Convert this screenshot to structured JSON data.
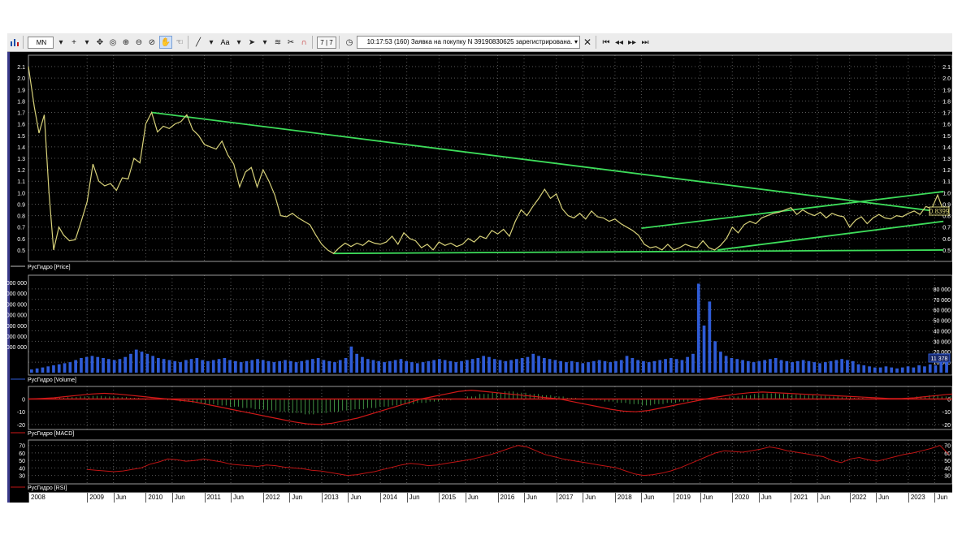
{
  "toolbar": {
    "timeframe": "MN",
    "font_label": "Aa",
    "page_indicator": "7 | 7",
    "message": "10:17:53  (160) Заявка на покупку N 39190830625 зарегистрирована."
  },
  "price_panel": {
    "legend": "РусГидро [Price]",
    "current_value": "0.8399",
    "y_ticks": [
      "2.1",
      "2.0",
      "1.9",
      "1.8",
      "1.7",
      "1.6",
      "1.5",
      "1.4",
      "1.3",
      "1.2",
      "1.1",
      "1.0",
      "0.9",
      "0.8",
      "0.7",
      "0.6",
      "0.5"
    ]
  },
  "volume_panel": {
    "legend": "РусГидро [Volume]",
    "current_value": "11 378",
    "right_ticks": [
      "80 000",
      "70 000",
      "60 000",
      "50 000",
      "40 000",
      "30 000",
      "20 000",
      "10 000"
    ],
    "left_ticks": [
      "000 000",
      "000 000",
      "000 000",
      "000 000",
      "000 000",
      "000 000",
      "000 000"
    ]
  },
  "macd_panel": {
    "legend": "РусГидро [MACD]",
    "ticks": [
      "0",
      "-10",
      "-20"
    ],
    "left_ticks": [
      "0",
      "-10",
      "-20"
    ]
  },
  "rsi_panel": {
    "legend": "РусГидро [RSI]",
    "ticks": [
      "70",
      "60",
      "50",
      "40",
      "30"
    ],
    "left_ticks": [
      "70",
      "60",
      "50",
      "40",
      "30"
    ]
  },
  "time_axis": [
    {
      "label": "2008",
      "t": 2008.0
    },
    {
      "label": "2009",
      "t": 2009.0
    },
    {
      "label": "Jun",
      "t": 2009.45
    },
    {
      "label": "2010",
      "t": 2010.0
    },
    {
      "label": "Jun",
      "t": 2010.45
    },
    {
      "label": "2011",
      "t": 2011.0
    },
    {
      "label": "Jun",
      "t": 2011.45
    },
    {
      "label": "2012",
      "t": 2012.0
    },
    {
      "label": "Jun",
      "t": 2012.45
    },
    {
      "label": "2013",
      "t": 2013.0
    },
    {
      "label": "Jun",
      "t": 2013.45
    },
    {
      "label": "2014",
      "t": 2014.0
    },
    {
      "label": "Jun",
      "t": 2014.45
    },
    {
      "label": "2015",
      "t": 2015.0
    },
    {
      "label": "Jun",
      "t": 2015.45
    },
    {
      "label": "2016",
      "t": 2016.0
    },
    {
      "label": "Jun",
      "t": 2016.45
    },
    {
      "label": "2017",
      "t": 2017.0
    },
    {
      "label": "Jun",
      "t": 2017.45
    },
    {
      "label": "2018",
      "t": 2018.0
    },
    {
      "label": "Jun",
      "t": 2018.45
    },
    {
      "label": "2019",
      "t": 2019.0
    },
    {
      "label": "Jun",
      "t": 2019.45
    },
    {
      "label": "2020",
      "t": 2020.0
    },
    {
      "label": "Jun",
      "t": 2020.45
    },
    {
      "label": "2021",
      "t": 2021.0
    },
    {
      "label": "Jun",
      "t": 2021.45
    },
    {
      "label": "2022",
      "t": 2022.0
    },
    {
      "label": "Jun",
      "t": 2022.45
    },
    {
      "label": "2023",
      "t": 2023.0
    },
    {
      "label": "Jun",
      "t": 2023.45
    }
  ],
  "colors": {
    "background": "#000000",
    "grid": "#5a5a5a",
    "price_line": "#d8d27a",
    "trendline": "#3ddc5a",
    "volume_bar": "#2e5bd6",
    "macd_line": "#d01818",
    "macd_hist": "#4caf50",
    "rsi_line": "#c01414",
    "axis_text": "#ffffff"
  },
  "chart_data": {
    "type": "line",
    "x_range": [
      2008.0,
      2023.75
    ],
    "price": {
      "ylim": [
        0.45,
        2.15
      ],
      "points": [
        [
          2008.0,
          2.1
        ],
        [
          2008.1,
          1.75
        ],
        [
          2008.18,
          1.52
        ],
        [
          2008.27,
          1.68
        ],
        [
          2008.35,
          1.0
        ],
        [
          2008.43,
          0.5
        ],
        [
          2008.52,
          0.7
        ],
        [
          2008.6,
          0.63
        ],
        [
          2008.7,
          0.58
        ],
        [
          2008.8,
          0.59
        ],
        [
          2008.9,
          0.75
        ],
        [
          2009.0,
          0.92
        ],
        [
          2009.1,
          1.25
        ],
        [
          2009.2,
          1.1
        ],
        [
          2009.3,
          1.06
        ],
        [
          2009.4,
          1.08
        ],
        [
          2009.5,
          1.02
        ],
        [
          2009.6,
          1.13
        ],
        [
          2009.7,
          1.12
        ],
        [
          2009.8,
          1.3
        ],
        [
          2009.9,
          1.26
        ],
        [
          2010.0,
          1.6
        ],
        [
          2010.1,
          1.7
        ],
        [
          2010.2,
          1.53
        ],
        [
          2010.3,
          1.58
        ],
        [
          2010.4,
          1.56
        ],
        [
          2010.5,
          1.6
        ],
        [
          2010.6,
          1.62
        ],
        [
          2010.7,
          1.68
        ],
        [
          2010.8,
          1.55
        ],
        [
          2010.9,
          1.5
        ],
        [
          2011.0,
          1.42
        ],
        [
          2011.1,
          1.4
        ],
        [
          2011.2,
          1.38
        ],
        [
          2011.3,
          1.45
        ],
        [
          2011.4,
          1.33
        ],
        [
          2011.5,
          1.25
        ],
        [
          2011.6,
          1.05
        ],
        [
          2011.7,
          1.18
        ],
        [
          2011.8,
          1.22
        ],
        [
          2011.9,
          1.05
        ],
        [
          2012.0,
          1.2
        ],
        [
          2012.1,
          1.1
        ],
        [
          2012.2,
          0.98
        ],
        [
          2012.3,
          0.8
        ],
        [
          2012.4,
          0.79
        ],
        [
          2012.5,
          0.82
        ],
        [
          2012.6,
          0.78
        ],
        [
          2012.7,
          0.75
        ],
        [
          2012.8,
          0.72
        ],
        [
          2012.9,
          0.63
        ],
        [
          2013.0,
          0.55
        ],
        [
          2013.1,
          0.5
        ],
        [
          2013.2,
          0.47
        ],
        [
          2013.3,
          0.52
        ],
        [
          2013.4,
          0.56
        ],
        [
          2013.5,
          0.53
        ],
        [
          2013.6,
          0.56
        ],
        [
          2013.7,
          0.54
        ],
        [
          2013.8,
          0.58
        ],
        [
          2013.9,
          0.56
        ],
        [
          2014.0,
          0.55
        ],
        [
          2014.1,
          0.57
        ],
        [
          2014.2,
          0.62
        ],
        [
          2014.3,
          0.55
        ],
        [
          2014.4,
          0.65
        ],
        [
          2014.5,
          0.6
        ],
        [
          2014.6,
          0.58
        ],
        [
          2014.7,
          0.52
        ],
        [
          2014.8,
          0.55
        ],
        [
          2014.9,
          0.5
        ],
        [
          2015.0,
          0.57
        ],
        [
          2015.1,
          0.54
        ],
        [
          2015.2,
          0.56
        ],
        [
          2015.3,
          0.53
        ],
        [
          2015.4,
          0.55
        ],
        [
          2015.5,
          0.6
        ],
        [
          2015.6,
          0.57
        ],
        [
          2015.7,
          0.62
        ],
        [
          2015.8,
          0.6
        ],
        [
          2015.9,
          0.67
        ],
        [
          2016.0,
          0.64
        ],
        [
          2016.1,
          0.68
        ],
        [
          2016.2,
          0.62
        ],
        [
          2016.3,
          0.75
        ],
        [
          2016.4,
          0.85
        ],
        [
          2016.5,
          0.8
        ],
        [
          2016.6,
          0.88
        ],
        [
          2016.7,
          0.95
        ],
        [
          2016.8,
          1.03
        ],
        [
          2016.9,
          0.95
        ],
        [
          2017.0,
          0.99
        ],
        [
          2017.1,
          0.86
        ],
        [
          2017.2,
          0.8
        ],
        [
          2017.3,
          0.78
        ],
        [
          2017.4,
          0.82
        ],
        [
          2017.5,
          0.77
        ],
        [
          2017.6,
          0.84
        ],
        [
          2017.7,
          0.79
        ],
        [
          2017.8,
          0.78
        ],
        [
          2017.9,
          0.75
        ],
        [
          2018.0,
          0.77
        ],
        [
          2018.1,
          0.73
        ],
        [
          2018.2,
          0.7
        ],
        [
          2018.3,
          0.67
        ],
        [
          2018.4,
          0.63
        ],
        [
          2018.5,
          0.55
        ],
        [
          2018.6,
          0.52
        ],
        [
          2018.7,
          0.53
        ],
        [
          2018.8,
          0.5
        ],
        [
          2018.9,
          0.55
        ],
        [
          2019.0,
          0.5
        ],
        [
          2019.1,
          0.52
        ],
        [
          2019.2,
          0.55
        ],
        [
          2019.3,
          0.53
        ],
        [
          2019.4,
          0.52
        ],
        [
          2019.5,
          0.58
        ],
        [
          2019.6,
          0.52
        ],
        [
          2019.7,
          0.5
        ],
        [
          2019.8,
          0.54
        ],
        [
          2019.9,
          0.6
        ],
        [
          2020.0,
          0.7
        ],
        [
          2020.1,
          0.65
        ],
        [
          2020.2,
          0.72
        ],
        [
          2020.3,
          0.75
        ],
        [
          2020.4,
          0.73
        ],
        [
          2020.5,
          0.78
        ],
        [
          2020.6,
          0.8
        ],
        [
          2020.7,
          0.82
        ],
        [
          2020.8,
          0.83
        ],
        [
          2020.9,
          0.85
        ],
        [
          2021.0,
          0.87
        ],
        [
          2021.1,
          0.81
        ],
        [
          2021.2,
          0.85
        ],
        [
          2021.3,
          0.82
        ],
        [
          2021.4,
          0.8
        ],
        [
          2021.5,
          0.83
        ],
        [
          2021.6,
          0.78
        ],
        [
          2021.7,
          0.82
        ],
        [
          2021.8,
          0.8
        ],
        [
          2021.9,
          0.79
        ],
        [
          2022.0,
          0.7
        ],
        [
          2022.1,
          0.76
        ],
        [
          2022.2,
          0.79
        ],
        [
          2022.3,
          0.73
        ],
        [
          2022.4,
          0.78
        ],
        [
          2022.5,
          0.81
        ],
        [
          2022.6,
          0.78
        ],
        [
          2022.7,
          0.77
        ],
        [
          2022.8,
          0.8
        ],
        [
          2022.9,
          0.79
        ],
        [
          2023.0,
          0.82
        ],
        [
          2023.1,
          0.84
        ],
        [
          2023.2,
          0.81
        ],
        [
          2023.3,
          0.88
        ],
        [
          2023.4,
          0.86
        ],
        [
          2023.5,
          0.98
        ],
        [
          2023.6,
          0.84
        ]
      ]
    },
    "trendlines": [
      {
        "from": [
          2010.1,
          1.7
        ],
        "to": [
          2023.6,
          0.83
        ]
      },
      {
        "from": [
          2013.2,
          0.47
        ],
        "to": [
          2023.6,
          0.5
        ]
      },
      {
        "from": [
          2018.45,
          0.69
        ],
        "to": [
          2023.6,
          1.01
        ]
      },
      {
        "from": [
          2019.75,
          0.5
        ],
        "to": [
          2023.6,
          0.75
        ]
      }
    ],
    "volume": {
      "ylim": [
        0,
        90000
      ],
      "bars": [
        3000,
        4000,
        5000,
        6000,
        7000,
        8000,
        9000,
        10000,
        12000,
        14000,
        15000,
        16000,
        15000,
        14000,
        13000,
        12000,
        13000,
        15000,
        18000,
        22000,
        20000,
        18000,
        16000,
        14000,
        13000,
        12000,
        11000,
        10000,
        12000,
        13000,
        14000,
        12000,
        11000,
        12000,
        13000,
        14000,
        12000,
        11000,
        10000,
        11000,
        12000,
        13000,
        12000,
        11000,
        10000,
        11000,
        12000,
        11000,
        10000,
        11000,
        12000,
        13000,
        14000,
        12000,
        11000,
        10000,
        12000,
        14000,
        25000,
        18000,
        15000,
        13000,
        12000,
        11000,
        10000,
        11000,
        12000,
        13000,
        11000,
        10000,
        9000,
        10000,
        11000,
        12000,
        13000,
        12000,
        11000,
        10000,
        11000,
        12000,
        13000,
        14000,
        16000,
        15000,
        13000,
        12000,
        11000,
        12000,
        13000,
        14000,
        15000,
        18000,
        16000,
        14000,
        13000,
        12000,
        11000,
        10000,
        11000,
        10000,
        9000,
        10000,
        11000,
        12000,
        11000,
        10000,
        11000,
        12000,
        16000,
        14000,
        12000,
        11000,
        10000,
        11000,
        12000,
        13000,
        14000,
        13000,
        12000,
        15000,
        18000,
        85000,
        45000,
        68000,
        30000,
        20000,
        16000,
        14000,
        13000,
        12000,
        11000,
        10000,
        11000,
        12000,
        13000,
        14000,
        12000,
        11000,
        10000,
        11000,
        12000,
        11000,
        10000,
        9000,
        10000,
        11000,
        12000,
        13000,
        12000,
        11000,
        8000,
        7000,
        6000,
        5000,
        5000,
        6000,
        5000,
        4000,
        5000,
        6000,
        5000,
        7000,
        6000,
        8000,
        7000,
        15000,
        11378
      ]
    },
    "macd": {
      "ylim": [
        -22,
        8
      ],
      "line": [
        0,
        0.5,
        1,
        2,
        3,
        4,
        4.5,
        4,
        3,
        2,
        1,
        0,
        -1,
        -2,
        -4,
        -6,
        -8,
        -10,
        -12,
        -14,
        -16,
        -18,
        -19.5,
        -20,
        -19,
        -17,
        -15,
        -12,
        -9,
        -6,
        -3,
        0,
        2,
        4,
        6,
        7,
        6,
        5,
        4,
        3,
        2,
        1,
        0,
        -2,
        -4,
        -6,
        -8,
        -9.5,
        -10,
        -9,
        -7,
        -5,
        -3,
        -1,
        1,
        2.5,
        4,
        5,
        5.5,
        5,
        4.5,
        4,
        3.5,
        3,
        2.5,
        2,
        1.5,
        1,
        0.5,
        0.5,
        1,
        2,
        3,
        4
      ],
      "histogram": [
        0,
        0.5,
        1,
        1.5,
        2,
        2.5,
        2,
        1.5,
        1,
        0.5,
        0,
        -1,
        -2,
        -3,
        -4,
        -5,
        -6,
        -7,
        -8,
        -9,
        -10,
        -11,
        -12,
        -11,
        -10,
        -9,
        -8,
        -7,
        -6,
        -5,
        -4,
        -3,
        -2,
        -1,
        0,
        2,
        4,
        5,
        6,
        5,
        4,
        3,
        2,
        1,
        0,
        -1,
        -2,
        -3,
        -4,
        -5,
        -4,
        -3,
        -2,
        -1,
        0,
        1,
        2,
        3,
        4,
        4.5,
        4,
        3.5,
        3,
        2.5,
        2,
        1.5,
        1,
        0.5,
        0,
        0.5,
        1,
        2,
        3,
        2
      ]
    },
    "rsi": {
      "ylim": [
        22,
        74
      ],
      "line": [
        38,
        37,
        36,
        35,
        36,
        38,
        40,
        45,
        48,
        52,
        51,
        49,
        50,
        52,
        50,
        48,
        45,
        44,
        43,
        42,
        44,
        43,
        41,
        40,
        39,
        37,
        36,
        34,
        32,
        30,
        31,
        33,
        35,
        38,
        41,
        44,
        46,
        45,
        43,
        44,
        46,
        48,
        50,
        52,
        55,
        58,
        62,
        66,
        70,
        68,
        63,
        58,
        55,
        52,
        50,
        48,
        46,
        44,
        42,
        40,
        36,
        32,
        30,
        31,
        33,
        36,
        40,
        45,
        50,
        55,
        60,
        63,
        62,
        61,
        63,
        65,
        68,
        66,
        63,
        61,
        59,
        57,
        55,
        50,
        47,
        52,
        54,
        51,
        49,
        52,
        55,
        58,
        60,
        63,
        66,
        70,
        58
      ]
    }
  }
}
